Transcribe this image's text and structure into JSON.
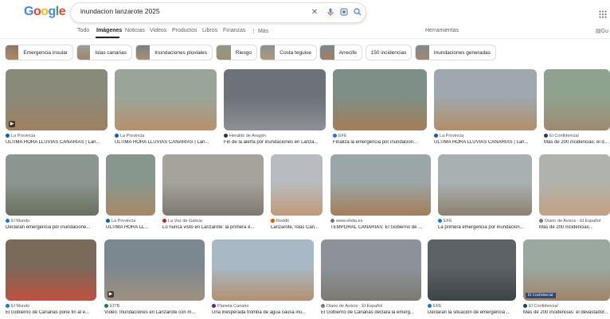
{
  "logo": {
    "letters": [
      "G",
      "o",
      "o",
      "g",
      "l",
      "e"
    ],
    "colors": [
      "#4285f4",
      "#ea4335",
      "#fbbc05",
      "#4285f4",
      "#34a853",
      "#ea4335"
    ]
  },
  "search": {
    "value": "inundacion lanzarote 2025"
  },
  "tabs": [
    "Todo",
    "Imágenes",
    "Noticias",
    "Videos",
    "Productos",
    "Libros",
    "Finanzas",
    "⋮ Más"
  ],
  "tools_label": "Herramientas",
  "partial_right_label": "Gu",
  "chips": [
    "Emergencia insular",
    "Islas canarias",
    "Inundaciones pluviales",
    "Riesgo",
    "Costa teguise",
    "Arrecife",
    "150 incidencias",
    "Inundaciones generadas"
  ],
  "results": [
    {
      "source": "La Provincia",
      "title": "ÚLTIMA HORA LLUVIAS CANARIAS | Lan...",
      "video": true,
      "colors": [
        "#8a8a7a",
        "#a08060"
      ]
    },
    {
      "source": "La Provincia",
      "title": "ÚLTIMA HORA LLUVIAS CANARIAS | Lan...",
      "video": false,
      "colors": [
        "#9aa59a",
        "#b8906a"
      ]
    },
    {
      "source": "Heraldo de Aragón",
      "title": "Fin de la alerta por inundaciones en Lanza...",
      "video": false,
      "colors": [
        "#6c7278",
        "#8d9196"
      ]
    },
    {
      "source": "EFE",
      "title": "Finaliza la emergencia por inundacion...",
      "video": false,
      "colors": [
        "#7d8f86",
        "#a47d55"
      ]
    },
    {
      "source": "La Provincia",
      "title": "ÚLTIMA HORA LLUVIAS CANARIAS | Lan...",
      "video": false,
      "colors": [
        "#9ea8ae",
        "#b38e68"
      ]
    },
    {
      "source": "El Confidencial",
      "title": "Más de 200 incidencias: el devastado...",
      "video": false,
      "colors": [
        "#8ea28f",
        "#9f8a70"
      ]
    },
    {
      "source": "El Mundo",
      "title": "Declaran emergencia por inundacione...",
      "video": false,
      "colors": [
        "#8c9690",
        "#6a7060"
      ]
    },
    {
      "source": "La Provincia",
      "title": "ÚLTIMA HORA LL...",
      "video": false,
      "colors": [
        "#88978e",
        "#a98866"
      ]
    },
    {
      "source": "La Voz de Galicia",
      "title": "Lo nunca visto en Lanzarote: la primera e...",
      "video": false,
      "colors": [
        "#a6a39c",
        "#7e7870"
      ]
    },
    {
      "source": "Reddit",
      "title": "Lanzarote, Islas Can...",
      "video": false,
      "colors": [
        "#b8bcc0",
        "#c09a78"
      ]
    },
    {
      "source": "www.elidia.es",
      "title": "TEMPORAL CANARIAS: El Gobierno de ...",
      "video": false,
      "colors": [
        "#9aa6a8",
        "#a47e58"
      ]
    },
    {
      "source": "EFE",
      "title": "La primera emergencia por inundacion...",
      "video": false,
      "colors": [
        "#a9b0b2",
        "#8d8170"
      ]
    },
    {
      "source": "Diario de Avisos - El Español",
      "title": "Más de 200 incidencias...",
      "video": false,
      "colors": [
        "#b0b2ae",
        "#c2a080"
      ]
    },
    {
      "source": "El Mundo",
      "title": "El Gobierno de Canarias pone fin al e...",
      "video": false,
      "colors": [
        "#7a6a5a",
        "#c05040"
      ]
    },
    {
      "source": "EITB",
      "title": "Vídeo: Inundaciones en Lanzarote con m...",
      "video": true,
      "colors": [
        "#7c8890",
        "#a09080"
      ]
    },
    {
      "source": "Planeta Canario",
      "title": "Una inesperada tromba de agua causa inu...",
      "video": false,
      "colors": [
        "#a8b8c4",
        "#b49070"
      ]
    },
    {
      "source": "Diario de Avisos - El Español",
      "title": "El Gobierno de Canarias declara la emerg...",
      "video": false,
      "colors": [
        "#8c9298",
        "#7d7a72"
      ]
    },
    {
      "source": "EFE",
      "title": "Declaran la situación de emergencia ...",
      "video": false,
      "colors": [
        "#5c6266",
        "#3e4446"
      ]
    },
    {
      "source": "El Confidencial",
      "title": "Más de 200 incidencias: el devastador...",
      "video": false,
      "colors": [
        "#9aa8a0",
        "#a08468"
      ]
    }
  ],
  "source_colors": {
    "La Provincia": "#0b57d0",
    "Heraldo de Aragón": "#333",
    "EFE": "#1a73e8",
    "El Confidencial": "#1f3c6e",
    "El Mundo": "#1a73e8",
    "La Voz de Galicia": "#c5221f",
    "Reddit": "#ff4500",
    "www.elidia.es": "#777",
    "Diario de Avisos - El Español": "#777",
    "EITB": "#188038",
    "Planeta Canario": "#6a1b9a"
  },
  "watermark": "El Confidencial"
}
